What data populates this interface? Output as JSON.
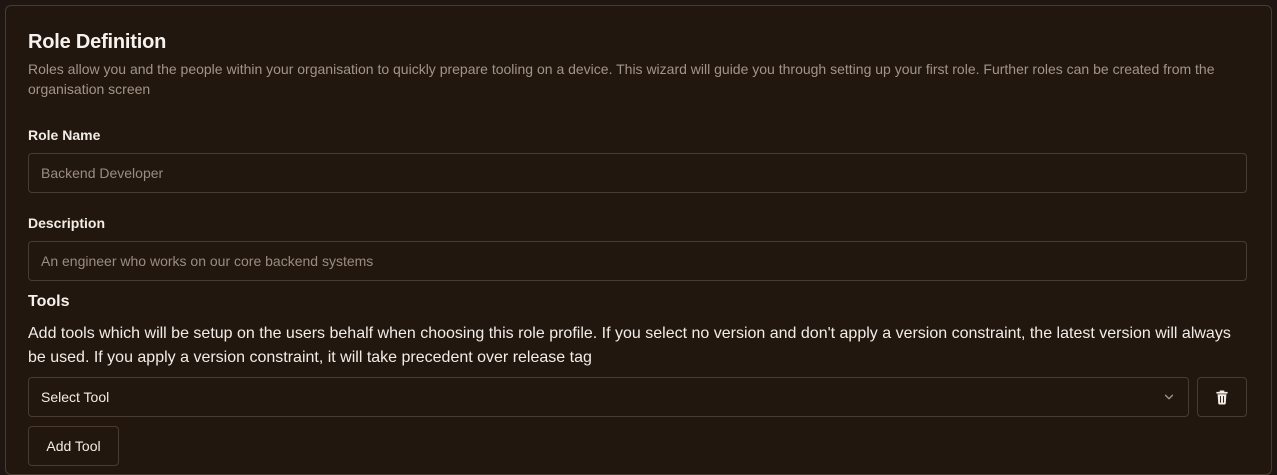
{
  "section": {
    "title": "Role Definition",
    "description": "Roles allow you and the people within your organisation to quickly prepare tooling on a device. This wizard will guide you through setting up your first role. Further roles can be created from the organisation screen"
  },
  "fields": {
    "role_name": {
      "label": "Role Name",
      "placeholder": "Backend Developer"
    },
    "description": {
      "label": "Description",
      "placeholder": "An engineer who works on our core backend systems"
    }
  },
  "tools": {
    "title": "Tools",
    "description": "Add tools which will be setup on the users behalf when choosing this role profile. If you select no version and don't apply a version constraint, the latest version will always be used. If you apply a version constraint, it will take precedent over release tag",
    "select_placeholder": "Select Tool",
    "add_label": "Add Tool"
  },
  "icons": {
    "dropdown": "chevron-down-icon",
    "delete": "trash-icon"
  },
  "colors": {
    "background": "#22170f",
    "border": "#4a3b30",
    "muted_text": "#a39487"
  }
}
